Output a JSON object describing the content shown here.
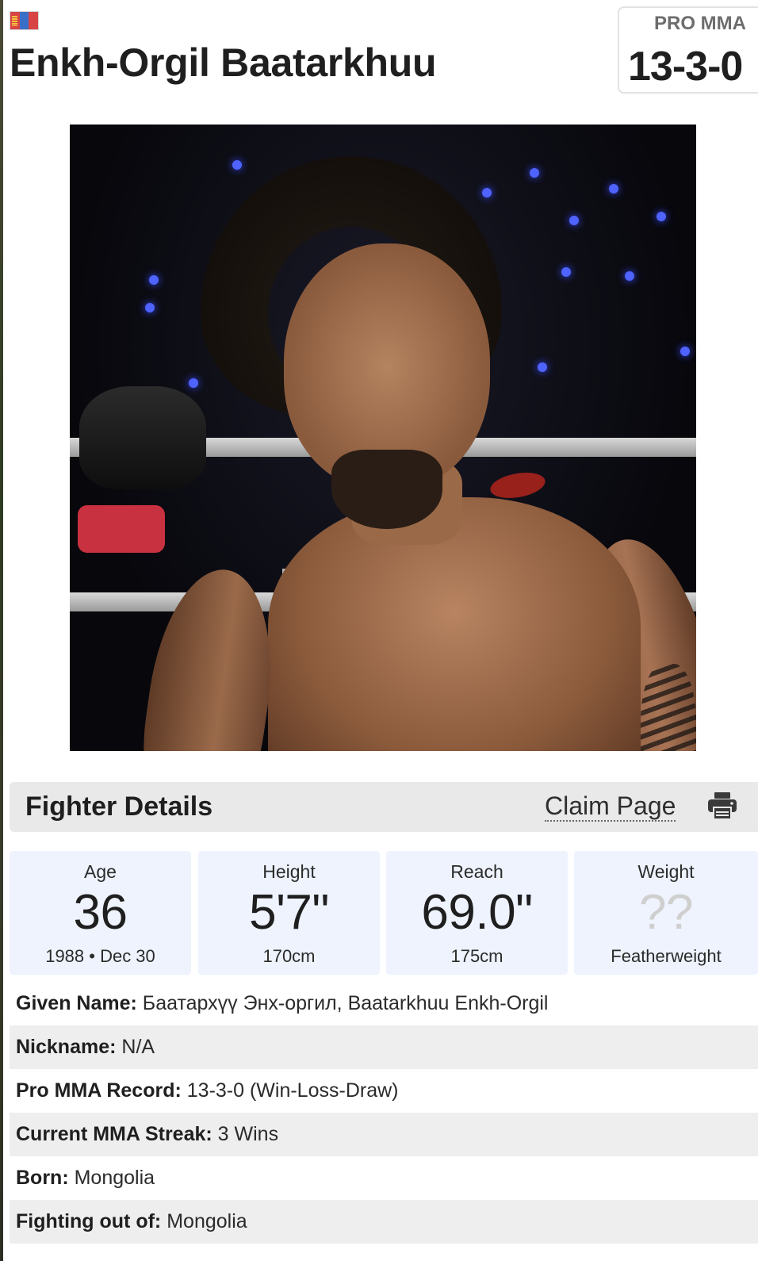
{
  "header": {
    "flag_icon": "mongolia-flag-icon",
    "name": "Enkh-Orgil Baatarkhuu",
    "record_label": "PRO MMA",
    "record_value": "13-3-0"
  },
  "photo": {
    "subject": "fighter-portrait-photo"
  },
  "details_bar": {
    "title": "Fighter Details",
    "claim_link": "Claim Page",
    "print_icon": "printer-icon"
  },
  "stats": [
    {
      "label": "Age",
      "value": "36",
      "sub": "1988 • Dec 30"
    },
    {
      "label": "Height",
      "value": "5'7\"",
      "sub": "170cm"
    },
    {
      "label": "Reach",
      "value": "69.0\"",
      "sub": "175cm"
    },
    {
      "label": "Weight",
      "value": "??",
      "sub": "Featherweight"
    }
  ],
  "info": [
    {
      "key": "Given Name:",
      "value": "Баатархүү Энх-оргил, Baatarkhuu Enkh-Orgil"
    },
    {
      "key": "Nickname:",
      "value": "N/A"
    },
    {
      "key": "Pro MMA Record:",
      "value": "13-3-0 (Win-Loss-Draw)"
    },
    {
      "key": "Current MMA Streak:",
      "value": "3 Wins"
    },
    {
      "key": "Born:",
      "value": "Mongolia"
    },
    {
      "key": "Fighting out of:",
      "value": "Mongolia"
    }
  ],
  "colors": {
    "stat_card_bg": "#eef3fd",
    "details_bar_bg": "#e9e9e9",
    "row_shade": "#eeeeee",
    "unknown_value": "#cfcfcf"
  }
}
